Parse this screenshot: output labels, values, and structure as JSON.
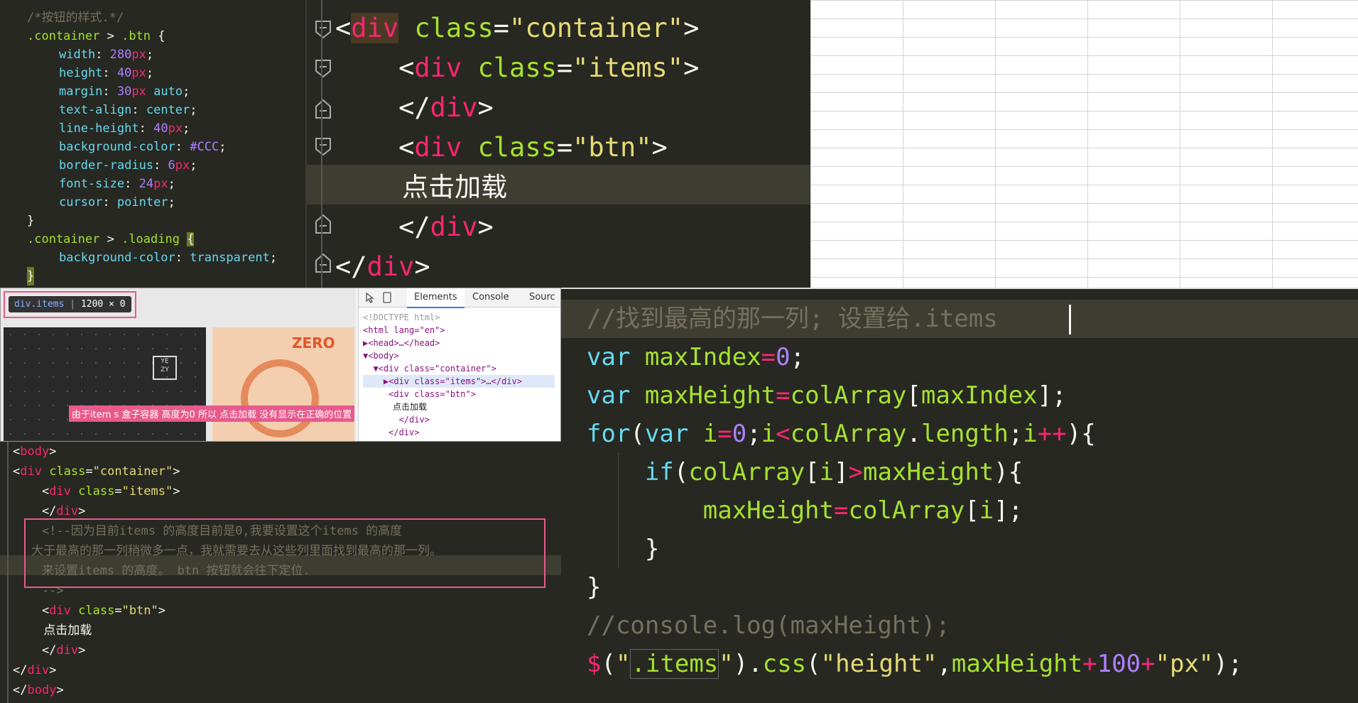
{
  "css_panel": {
    "lines": [
      "/*按钮的样式.*/",
      ".container > .btn {",
      "    width: 280px;",
      "    height: 40px;",
      "    margin: 30px auto;",
      "    text-align: center;",
      "    line-height: 40px;",
      "    background-color: #CCC;",
      "    border-radius: 6px;",
      "    font-size: 24px;",
      "    cursor: pointer;",
      "}",
      ".container > .loading {",
      "    background-color: transparent;",
      "}"
    ]
  },
  "html_zoom_panel": {
    "lines": [
      "<div class=\"container\">",
      "    <div class=\"items\">",
      "    </div>",
      "    <div class=\"btn\">",
      "        点击加载",
      "    </div>",
      "</div>"
    ]
  },
  "devtools": {
    "tooltip_tag": "div.items",
    "tooltip_size": "1200 × 0",
    "tabs": [
      "Elements",
      "Console",
      "Sourc"
    ],
    "active_tab": "Elements",
    "tree": [
      "<!DOCTYPE html>",
      "<html lang=\"en\">",
      "▶<head>…</head>",
      "▼<body>",
      "  ▼<div class=\"container\">",
      "    ▶<div class=\"items\">…</div>",
      "     <div class=\"btn\">",
      "           点击加载",
      "       </div>",
      "     </div>"
    ],
    "annotation": "由于item s 盒子容器 高度为0 所以 点击加载 没有显示在正确的位置",
    "preview_label": "点击加载",
    "logo_text": "ZERO",
    "yezy_text": "YE\nZY"
  },
  "html_comment_panel": {
    "lines": [
      "<body>",
      "<div class=\"container\">",
      "    <div class=\"items\">",
      "    </div>",
      "    <!--因为目前items 的高度目前是0,我要设置这个items 的高度",
      "大于最高的那一列稍微多一点，我就需要去从这些列里面找到最高的那一列。",
      "    来设置items 的高度。 btn 按钮就会往下定位.",
      "    -->",
      "    <div class=\"btn\">",
      "        点击加载",
      "    </div>",
      "</div>",
      "</body>"
    ]
  },
  "js_panel": {
    "lines": [
      "//找到最高的那一列; 设置给.items",
      "var maxIndex=0;",
      "var maxHeight=colArray[maxIndex];",
      "for(var i=0;i<colArray.length;i++){",
      "    if(colArray[i]>maxHeight){",
      "        maxHeight=colArray[i];",
      "    }",
      "}",
      "//console.log(maxHeight);",
      "$(\".items\").css(\"height\",maxHeight+100+\"px\");"
    ]
  },
  "colors": {
    "editor_bg": "#272822",
    "keyword": "#66d9ef",
    "string": "#e6db74",
    "tag": "#f92672",
    "attr": "#a6e22e",
    "number": "#ae81ff",
    "comment": "#75715e",
    "annotation_border": "#e85a8c"
  }
}
